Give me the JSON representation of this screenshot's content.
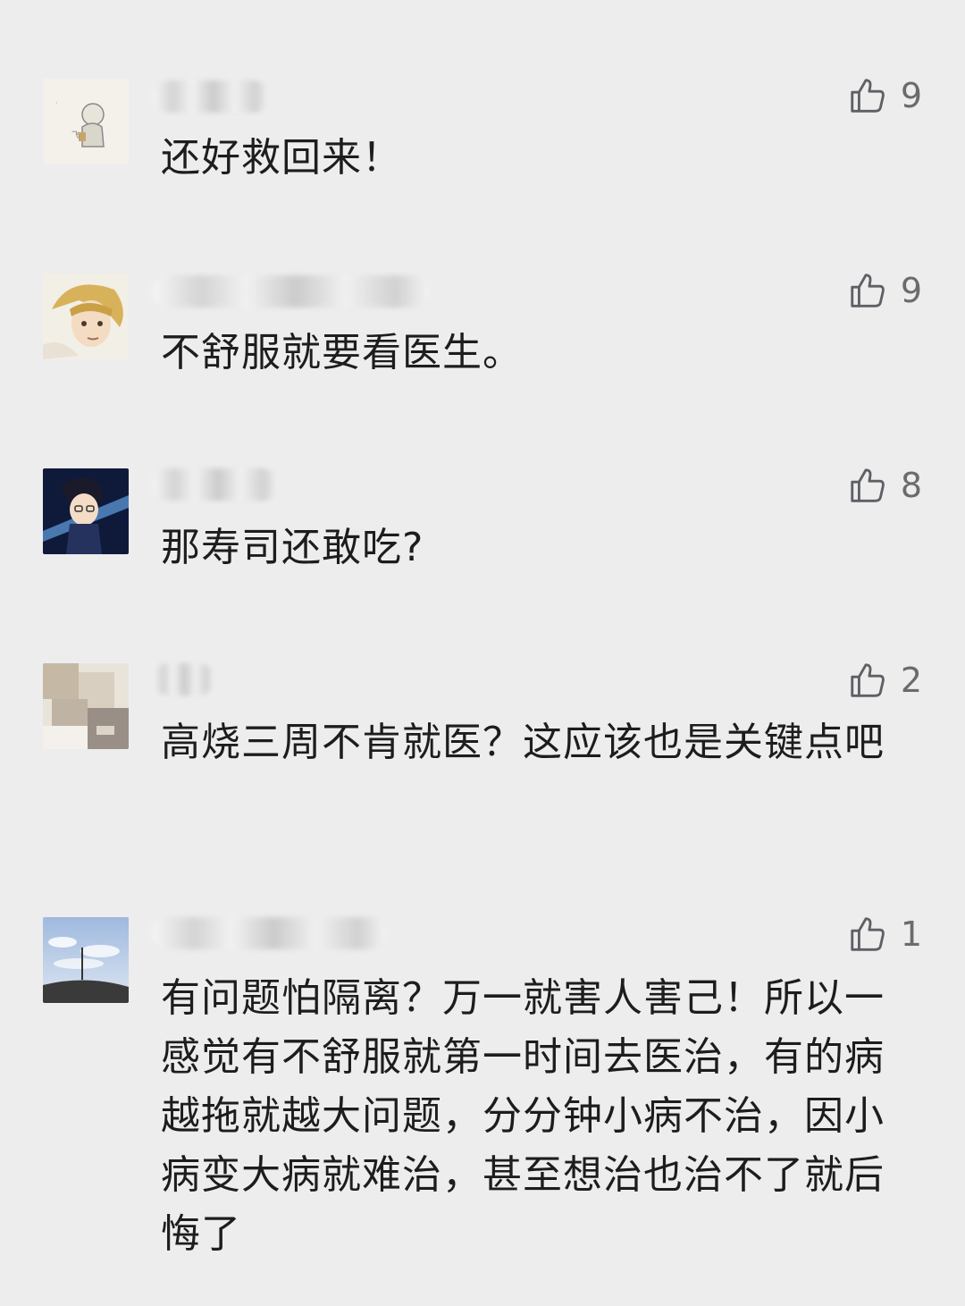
{
  "comments": [
    {
      "text": "还好救回来！",
      "likes": "9",
      "avatar_icon": "old-man-drawing-avatar"
    },
    {
      "text": "不舒服就要看医生。",
      "likes": "9",
      "avatar_icon": "anime-blonde-character-avatar"
    },
    {
      "text": "那寿司还敢吃?",
      "likes": "8",
      "avatar_icon": "anime-detective-character-avatar"
    },
    {
      "text": "高烧三周不肯就医？这应该也是关键点吧",
      "likes": "2",
      "avatar_icon": "blurred-person-avatar"
    },
    {
      "text": "有问题怕隔离？万一就害人害己！所以一感觉有不舒服就第一时间去医治，有的病越拖就越大问题，分分钟小病不治，因小病变大病就难治，甚至想治也治不了就后悔了",
      "likes": "1",
      "avatar_icon": "sky-landscape-avatar"
    }
  ],
  "like_icon": "thumbs-up-icon",
  "colors": {
    "background": "#ededed",
    "text": "#1d1d1d",
    "like": "#6b6b6b"
  }
}
